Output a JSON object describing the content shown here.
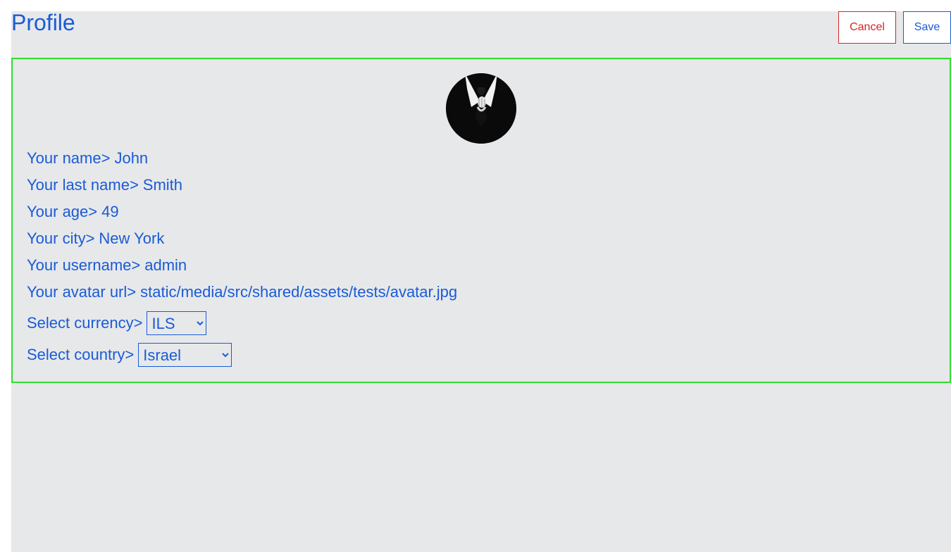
{
  "header": {
    "title": "Profile",
    "cancel_label": "Cancel",
    "save_label": "Save"
  },
  "profile": {
    "fields": [
      {
        "label": "Your name>",
        "value": "John"
      },
      {
        "label": "Your last name>",
        "value": "Smith"
      },
      {
        "label": "Your age>",
        "value": "49"
      },
      {
        "label": "Your city>",
        "value": "New York"
      },
      {
        "label": "Your username>",
        "value": "admin"
      },
      {
        "label": "Your avatar url>",
        "value": "static/media/src/shared/assets/tests/avatar.jpg"
      }
    ],
    "currency": {
      "label": "Select currency>",
      "selected": "ILS"
    },
    "country": {
      "label": "Select country>",
      "selected": "Israel"
    },
    "avatar_icon": "suit-and-tie-avatar"
  },
  "colors": {
    "text": "#1a5bd6",
    "cancel": "#d42424",
    "card_border": "#2ee02e",
    "background": "#e7e8ea"
  }
}
